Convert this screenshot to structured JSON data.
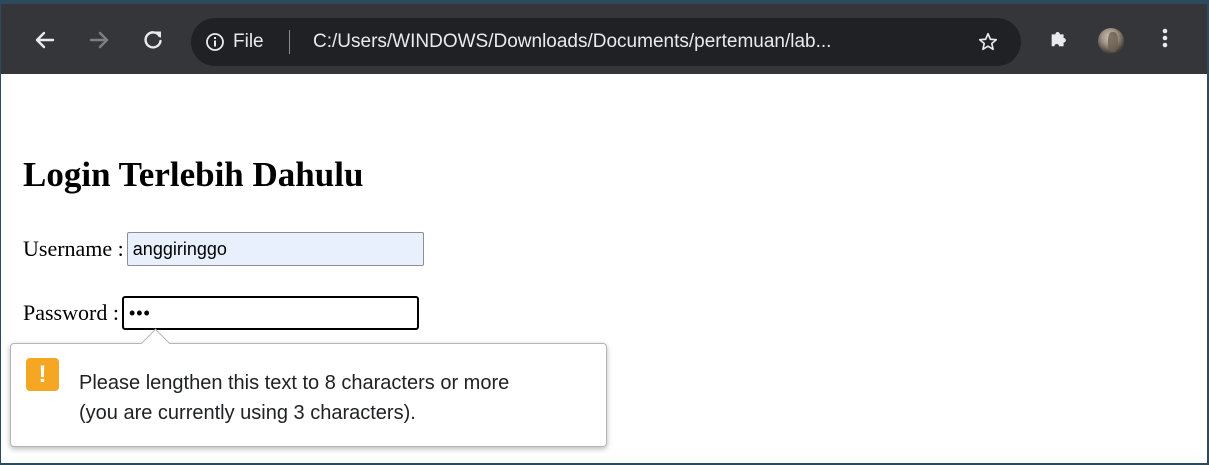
{
  "browser": {
    "scheme_label": "File",
    "url": "C:/Users/WINDOWS/Downloads/Documents/pertemuan/lab...",
    "icons": {
      "back": "back-arrow-icon",
      "forward": "forward-arrow-icon",
      "reload": "reload-icon",
      "info": "info-icon",
      "bookmark": "star-icon",
      "extensions": "puzzle-icon",
      "profile": "avatar",
      "menu": "kebab-menu-icon"
    },
    "colors": {
      "toolbar": "#35363a",
      "omnibox": "#202124",
      "text": "#e8eaed"
    }
  },
  "page": {
    "title": "Login Terlebih Dahulu",
    "username": {
      "label": "Username :",
      "value": "anggiringgo"
    },
    "password": {
      "label": "Password :",
      "value": "•••"
    }
  },
  "validation": {
    "icon": "warning-icon",
    "icon_glyph": "!",
    "line1": "Please lengthen this text to 8 characters or more",
    "line2": "(you are currently using 3 characters).",
    "accent_color": "#f5a623"
  }
}
